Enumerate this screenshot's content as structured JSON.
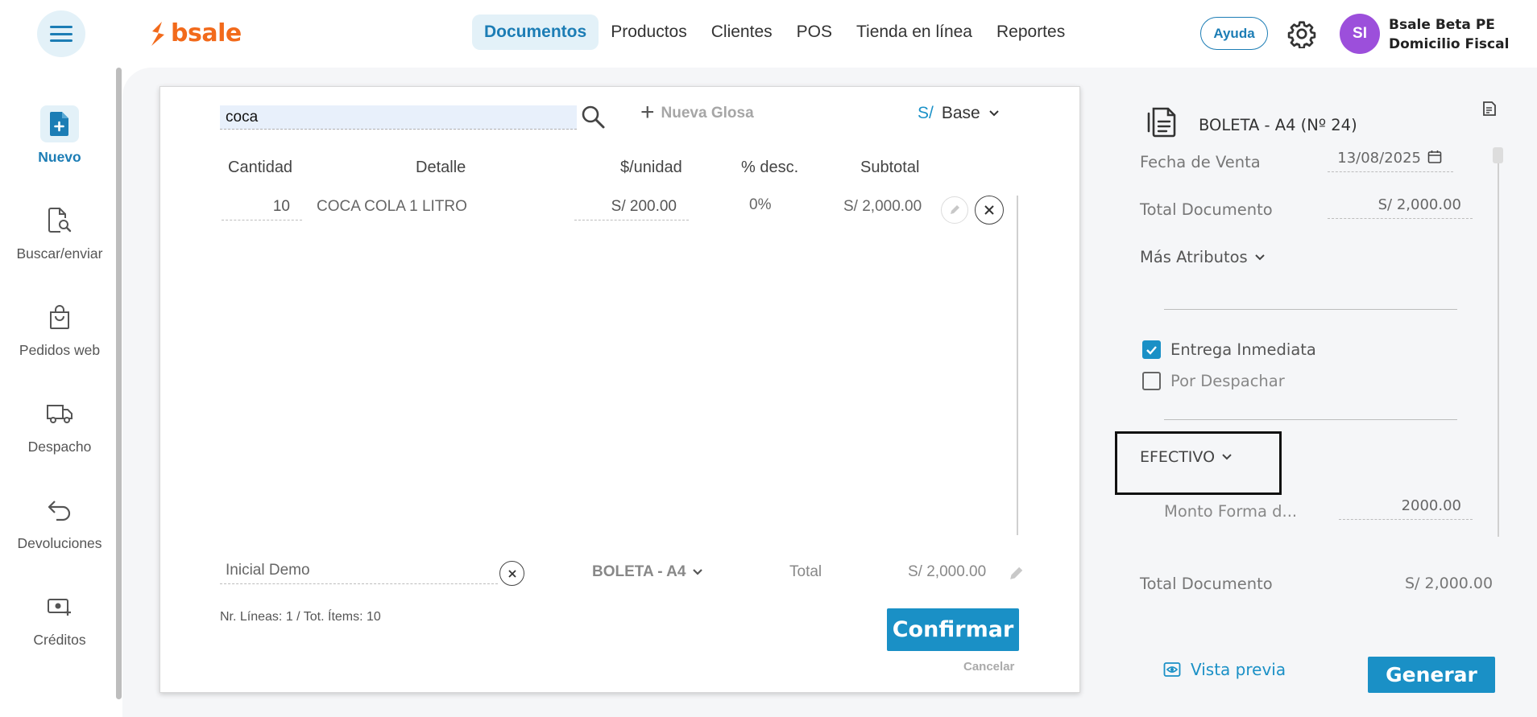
{
  "logo": {
    "text": "bsale"
  },
  "nav": {
    "items": [
      {
        "label": "Documentos",
        "active": true
      },
      {
        "label": "Productos"
      },
      {
        "label": "Clientes"
      },
      {
        "label": "POS"
      },
      {
        "label": "Tienda en línea"
      },
      {
        "label": "Reportes"
      }
    ],
    "help_label": "Ayuda"
  },
  "account": {
    "initials": "SI",
    "name": "Bsale Beta PE",
    "branch": "Domicilio Fiscal",
    "avatar_color": "#9c4fdb"
  },
  "sidebar": {
    "items": [
      {
        "label": "Nuevo",
        "icon": "new-document-icon",
        "active": true
      },
      {
        "label": "Buscar/enviar",
        "icon": "search-document-icon"
      },
      {
        "label": "Pedidos web",
        "icon": "shopping-bag-icon"
      },
      {
        "label": "Despacho",
        "icon": "truck-icon"
      },
      {
        "label": "Devoluciones",
        "icon": "return-arrow-icon"
      },
      {
        "label": "Créditos",
        "icon": "cash-plus-icon"
      }
    ]
  },
  "editor": {
    "search_value": "coca",
    "nueva_glosa": "Nueva Glosa",
    "currency_symbol": "S/",
    "price_list": "Base",
    "columns": [
      "Cantidad",
      "Detalle",
      "$/unidad",
      "% desc.",
      "Subtotal"
    ],
    "lines": [
      {
        "qty": "10",
        "detail": "COCA COLA 1 LITRO",
        "unit_price": "S/ 200.00",
        "discount": "0%",
        "subtotal": "S/ 2,000.00"
      }
    ],
    "client": "Inicial Demo",
    "doc_type": "BOLETA - A4",
    "total_label": "Total",
    "total_value": "S/ 2,000.00",
    "summary": "Nr. Líneas: 1 / Tot. Ítems: 10",
    "confirm_label": "Confirmar",
    "cancel_label": "Cancelar"
  },
  "document": {
    "title": "BOLETA - A4 (Nº 24)",
    "fecha_label": "Fecha de Venta",
    "fecha_value": "13/08/2025",
    "total_label": "Total Documento",
    "total_value": "S/ 2,000.00",
    "mas_atributos": "Más Atributos",
    "entrega_inmediata": "Entrega Inmediata",
    "entrega_checked": true,
    "por_despachar": "Por Despachar",
    "por_despachar_checked": false,
    "payment_method": "EFECTIVO",
    "monto_label": "Monto Forma d...",
    "monto_value": "2000.00",
    "total_doc_label": "Total Documento",
    "total_doc_value": "S/ 2,000.00",
    "vista_previa": "Vista previa",
    "generar": "Generar"
  },
  "colors": {
    "accent": "#1a90c6",
    "brand": "#f26a1b",
    "nav_active_bg": "#e3f1f8"
  }
}
